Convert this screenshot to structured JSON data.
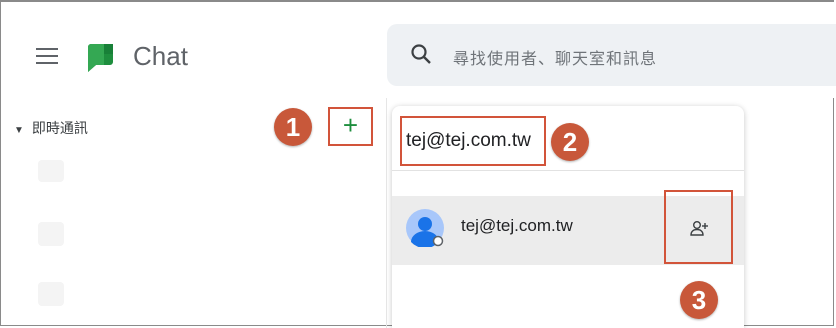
{
  "app": {
    "title": "Chat"
  },
  "search": {
    "placeholder": "尋找使用者、聊天室和訊息"
  },
  "sidebar": {
    "section_label": "即時通訊",
    "new_chat_label": "+"
  },
  "new_chat_panel": {
    "input_value": "tej@tej.com.tw",
    "result": {
      "email": "tej@tej.com.tw"
    }
  },
  "annotations": {
    "step1": "1",
    "step2": "2",
    "step3": "3"
  },
  "colors": {
    "accent_red": "#d2543a",
    "badge": "#c8583a",
    "chat_green": "#1e8e3e",
    "search_bg": "#eef1f4",
    "row_bg": "#ececec"
  },
  "icons": {
    "menu": "hamburger-icon",
    "logo": "google-chat-logo",
    "search": "search-icon",
    "avatar": "person-avatar-icon",
    "add": "add-person-icon"
  }
}
